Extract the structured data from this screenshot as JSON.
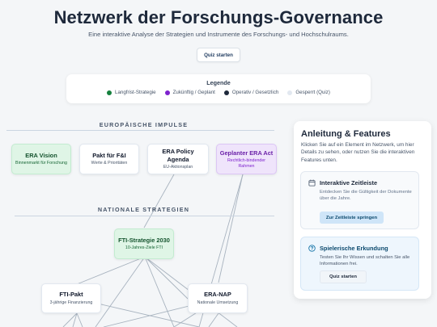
{
  "header": {
    "title": "Netzwerk der Forschungs-Governance",
    "subtitle": "Eine interaktive Analyse der Strategien und Instrumente des Forschungs- und Hochschulraums.",
    "quiz_button": "Quiz starten"
  },
  "legend": {
    "title": "Legende",
    "items": [
      {
        "label": "Langfrist-Strategie",
        "color": "#15803d"
      },
      {
        "label": "Zukünftig / Geplant",
        "color": "#7e22ce"
      },
      {
        "label": "Operativ / Gesetzlich",
        "color": "#1e293b"
      },
      {
        "label": "Gesperrt (Quiz)",
        "color": "#e2e8f0"
      }
    ]
  },
  "network": {
    "sections": {
      "european": "EUROPÄISCHE IMPULSE",
      "national": "NATIONALE STRATEGIEN"
    },
    "nodes": {
      "era_vision": {
        "title": "ERA Vision",
        "subtitle": "Binnenmarkt für Forschung"
      },
      "pakt_fi": {
        "title": "Pakt für F&I",
        "subtitle": "Werte & Prioritäten"
      },
      "era_policy": {
        "title": "ERA Policy Agenda",
        "subtitle": "EU-Aktionsplan"
      },
      "era_act": {
        "title": "Geplanter ERA Act",
        "subtitle": "Rechtlich-bindender Rahmen"
      },
      "fti_2030": {
        "title": "FTI-Strategie 2030",
        "subtitle": "10-Jahres-Ziele FTI"
      },
      "fti_pakt": {
        "title": "FTI-Pakt",
        "subtitle": "3-jährige Finanzierung"
      },
      "era_nap": {
        "title": "ERA-NAP",
        "subtitle": "Nationale Umsetzung"
      }
    }
  },
  "sidebar": {
    "title": "Anleitung & Features",
    "description": "Klicken Sie auf ein Element im Netzwerk, um hier Details zu sehen, oder nutzen Sie die interaktiven Features unten.",
    "timeline": {
      "icon": "calendar-icon",
      "title": "Interaktive Zeitleiste",
      "text": "Entdecken Sie die Gültigkeit der Dokumente über die Jahre.",
      "button": "Zur Zeitleiste springen"
    },
    "quiz": {
      "icon": "help-circle-icon",
      "title": "Spielerische Erkundung",
      "text": "Testen Sie Ihr Wissen und schalten Sie alle Informationen frei.",
      "button": "Quiz starten"
    }
  }
}
